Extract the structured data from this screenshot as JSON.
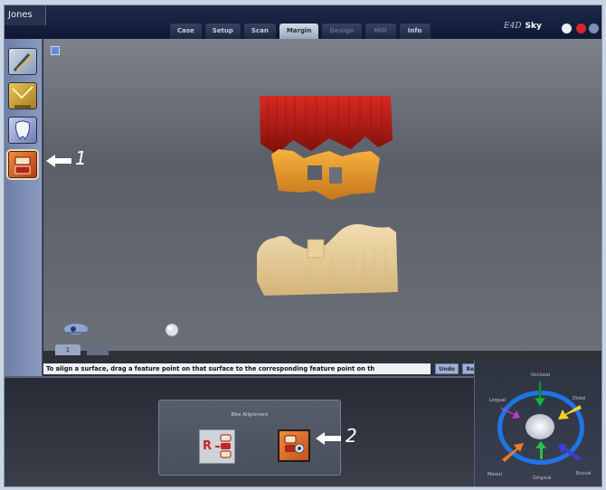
{
  "window": {
    "patient_tab": "Jones"
  },
  "workflow_tabs": [
    {
      "label": "Case",
      "state": "normal"
    },
    {
      "label": "Setup",
      "state": "normal"
    },
    {
      "label": "Scan",
      "state": "normal"
    },
    {
      "label": "Margin",
      "state": "active"
    },
    {
      "label": "Design",
      "state": "dim"
    },
    {
      "label": "Mill",
      "state": "dim"
    },
    {
      "label": "Info",
      "state": "normal"
    }
  ],
  "branding": {
    "product": "E4D",
    "name": "Sky"
  },
  "viewport": {
    "view_tabs": [
      {
        "label": "1"
      },
      {
        "label": ""
      }
    ],
    "colors": {
      "upper_margin": "#b81c1a",
      "prep_die": "#f0a22d",
      "lower_arch": "#e9cf95"
    }
  },
  "instruction": {
    "text": "To align a surface, drag a feature point on that surface to the corresponding feature point on th",
    "buttons": [
      "Undo",
      "Redo"
    ]
  },
  "align_panel": {
    "title": "Bite Alignment"
  },
  "navigation": {
    "labels": {
      "lingual": "Lingual",
      "distal": "Distal",
      "mesial": "Mesial",
      "buccal": "Buccal",
      "occlusal": "Occlusal",
      "gingival": "Gingival"
    },
    "colors": {
      "occlusal": "#19b24a",
      "lingual": "#c03dc8",
      "distal": "#f0d327",
      "mesial": "#f07a1f",
      "buccal": "#3b3fd1",
      "gingival": "#25c24a"
    }
  },
  "callouts": [
    {
      "label": "1"
    },
    {
      "label": "2"
    }
  ]
}
